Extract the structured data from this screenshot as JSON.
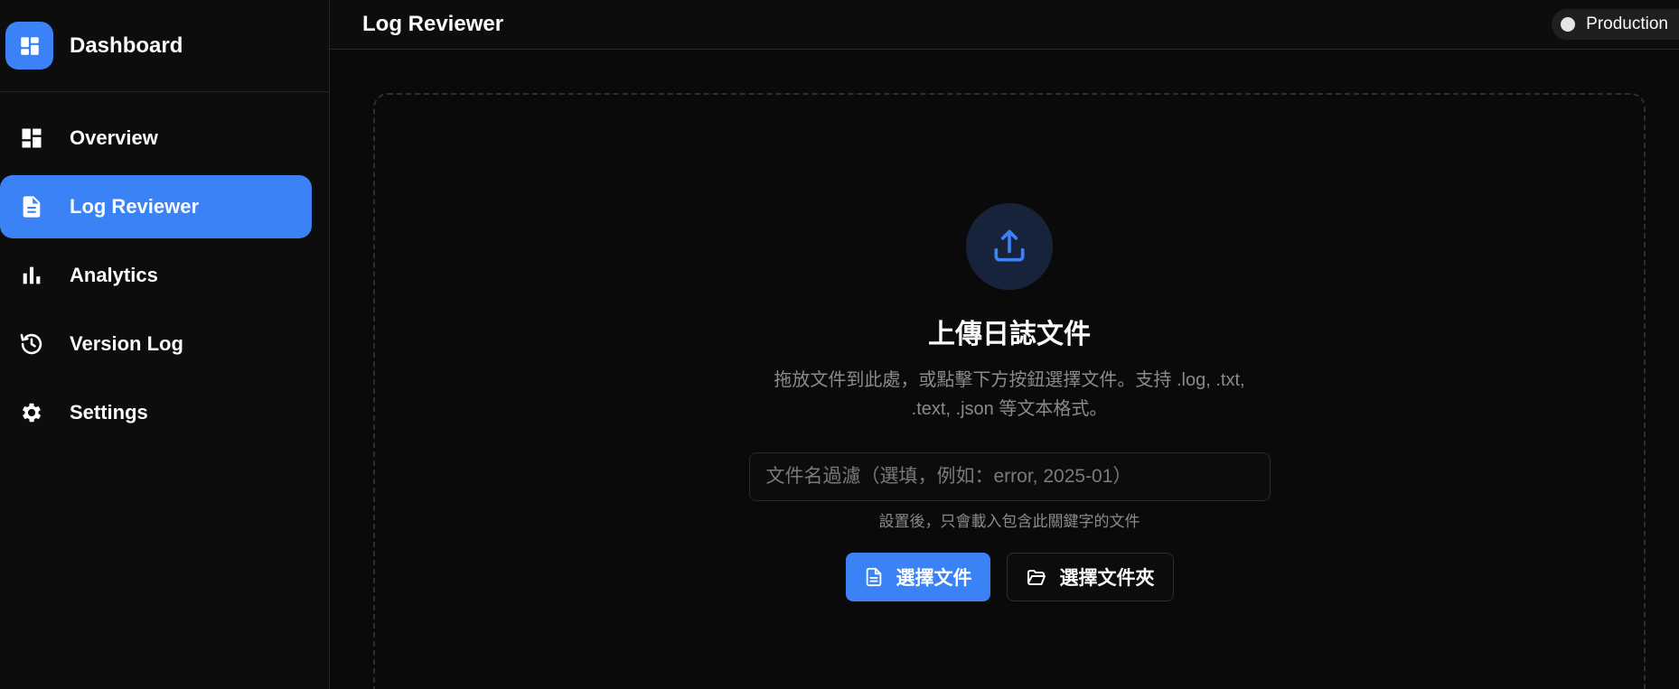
{
  "sidebar": {
    "brand": {
      "title": "Dashboard",
      "icon": "dashboard-icon"
    },
    "items": [
      {
        "label": "Overview",
        "icon": "grid-icon",
        "active": false
      },
      {
        "label": "Log Reviewer",
        "icon": "document-icon",
        "active": true
      },
      {
        "label": "Analytics",
        "icon": "bar-chart-icon",
        "active": false
      },
      {
        "label": "Version Log",
        "icon": "history-icon",
        "active": false
      },
      {
        "label": "Settings",
        "icon": "gear-icon",
        "active": false
      }
    ]
  },
  "header": {
    "title": "Log Reviewer",
    "environment": "Production"
  },
  "upload": {
    "title": "上傳日誌文件",
    "description": "拖放文件到此處，或點擊下方按鈕選擇文件。支持 .log, .txt, .text, .json 等文本格式。",
    "filter_placeholder": "文件名過濾（選填，例如：error, 2025-01）",
    "filter_value": "",
    "filter_hint": "設置後，只會載入包含此關鍵字的文件",
    "select_file_label": "選擇文件",
    "select_folder_label": "選擇文件夾"
  },
  "colors": {
    "accent": "#3b82f6",
    "background": "#0a0a0a",
    "sidebar": "#0d0d0d",
    "upload_circle": "#17233b"
  }
}
